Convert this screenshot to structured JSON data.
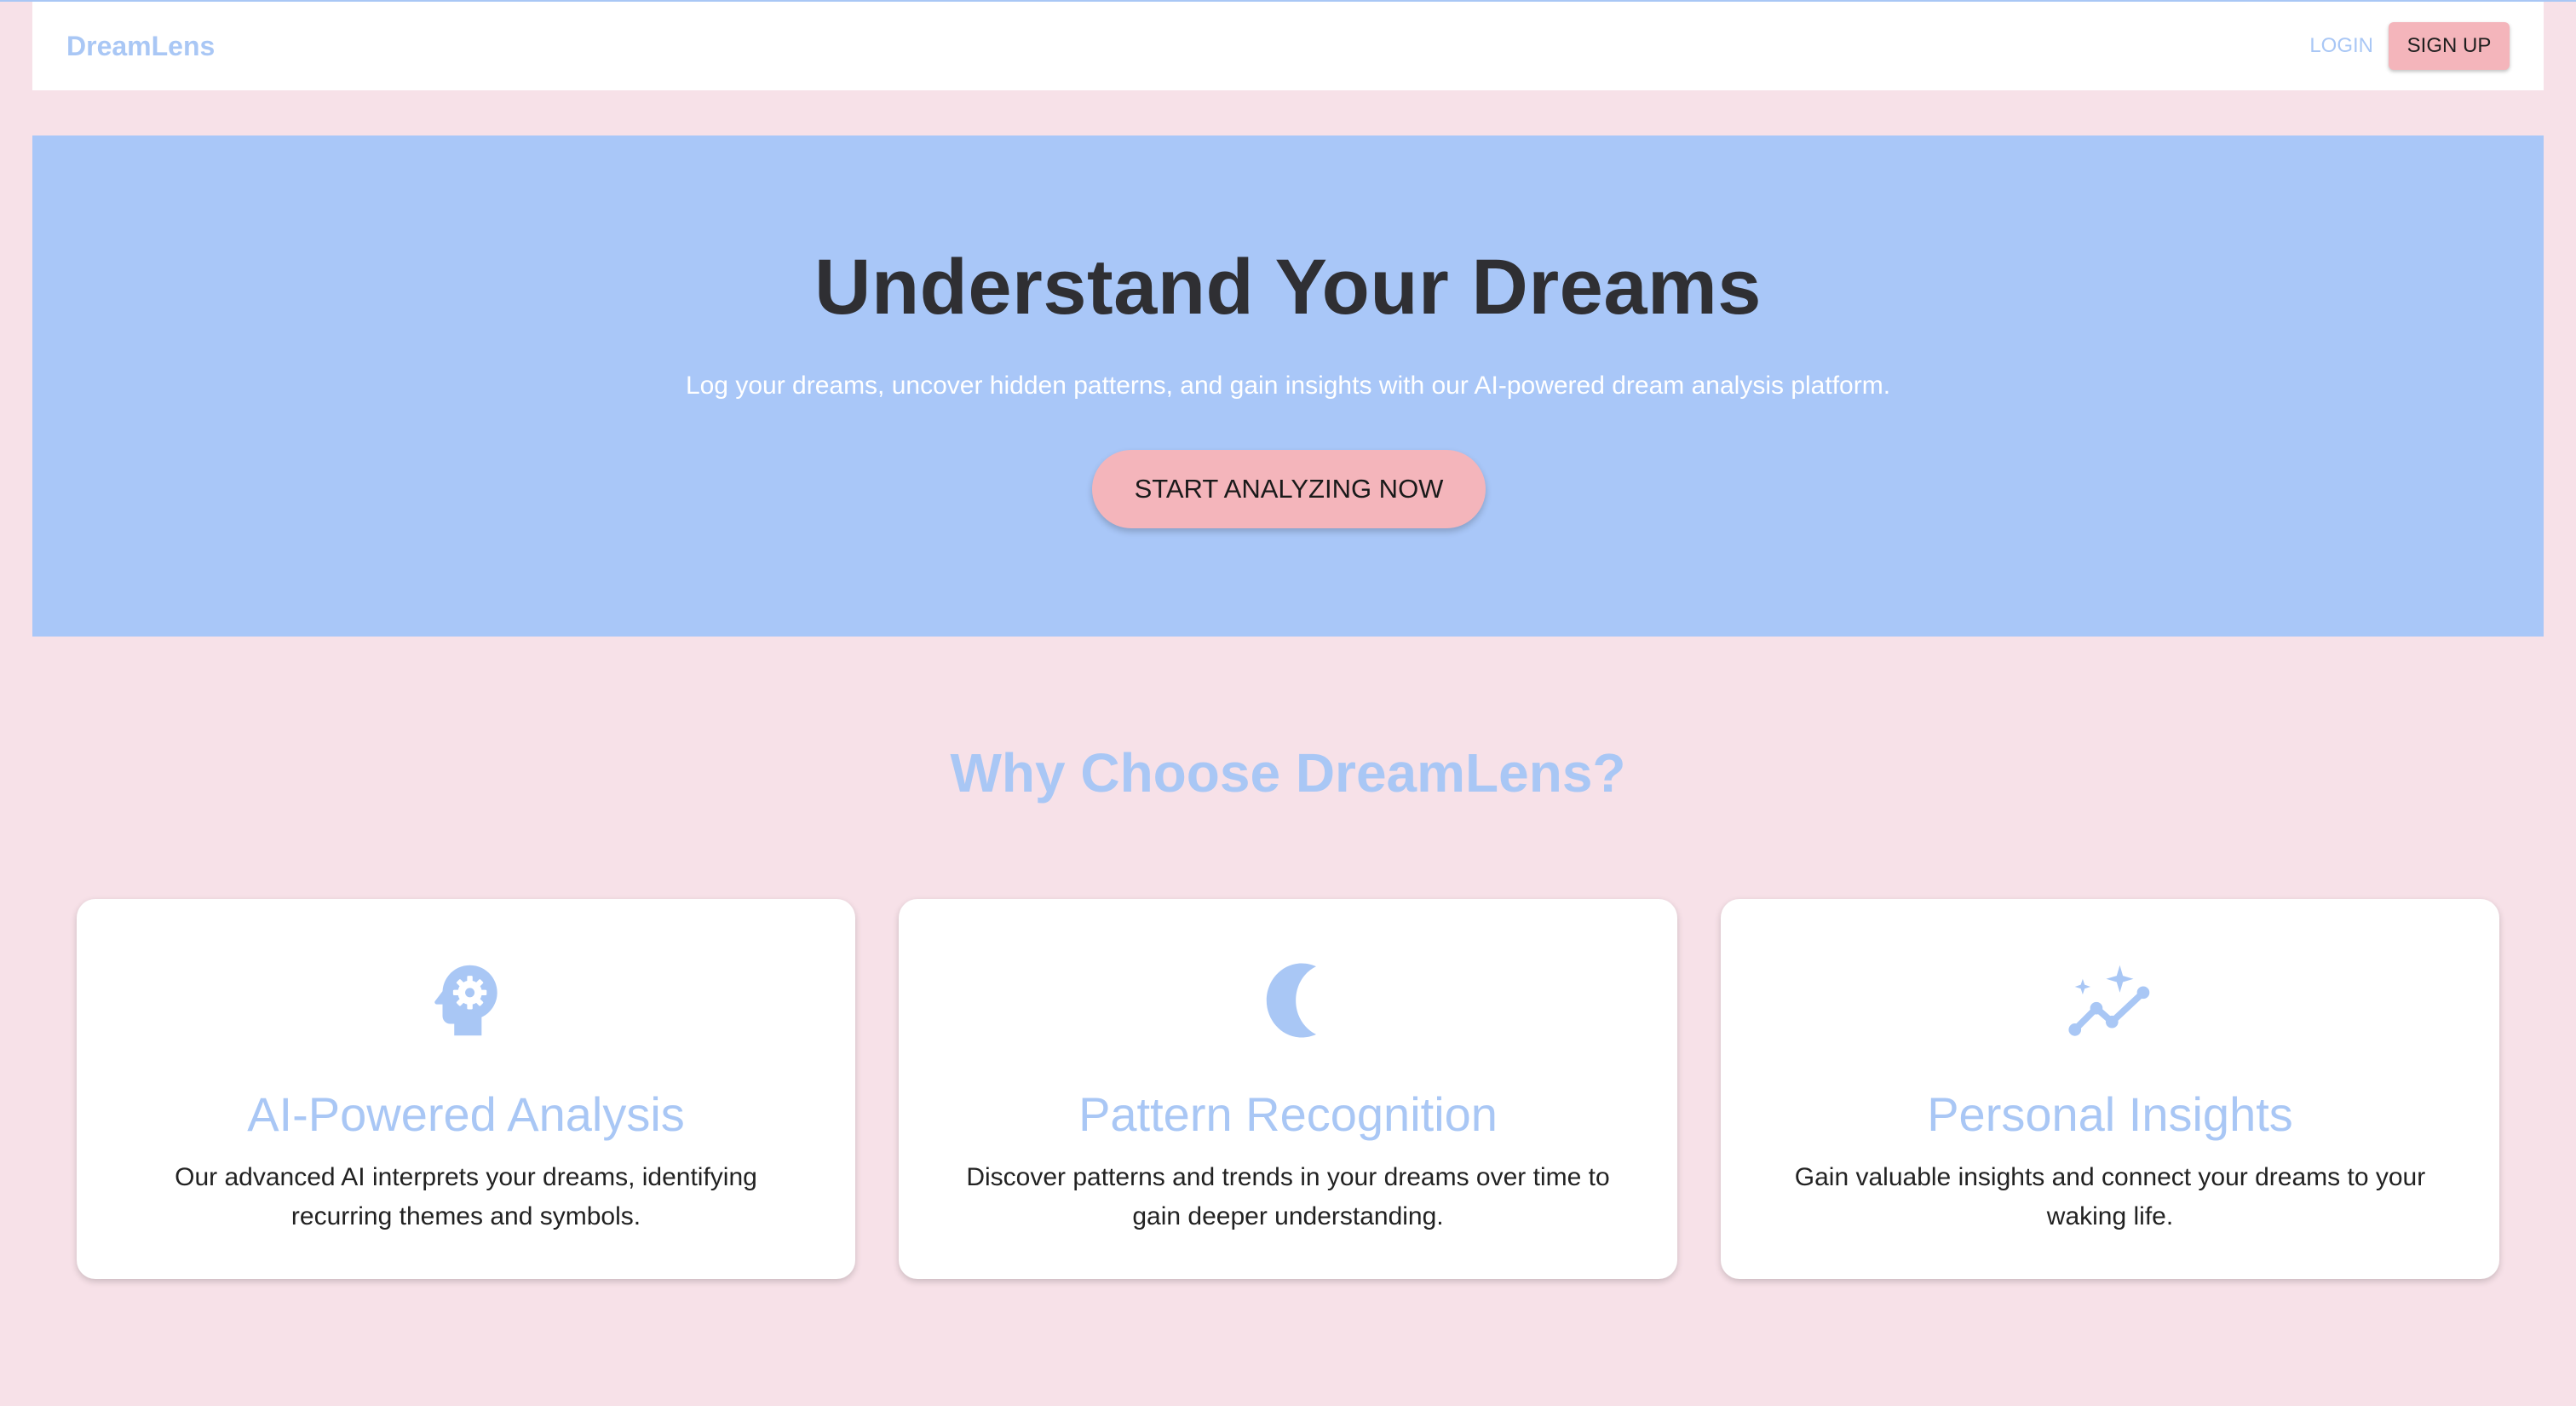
{
  "header": {
    "brand": "DreamLens",
    "login_label": "LOGIN",
    "signup_label": "SIGN UP"
  },
  "hero": {
    "title": "Understand Your Dreams",
    "subtitle": "Log your dreams, uncover hidden patterns, and gain insights with our AI-powered dream analysis platform.",
    "cta_label": "START ANALYZING NOW"
  },
  "features": {
    "title": "Why Choose DreamLens?",
    "cards": [
      {
        "icon": "head-gear-icon",
        "title": "AI-Powered Analysis",
        "description": "Our advanced AI interprets your dreams, identifying recurring themes and symbols."
      },
      {
        "icon": "moon-icon",
        "title": "Pattern Recognition",
        "description": "Discover patterns and trends in your dreams over time to gain deeper understanding."
      },
      {
        "icon": "sparkle-trend-icon",
        "title": "Personal Insights",
        "description": "Gain valuable insights and connect your dreams to your waking life."
      }
    ]
  },
  "colors": {
    "background": "#f7e1e8",
    "accent_blue": "#a9c7f5",
    "accent_pink": "#f4b5bb",
    "text_dark": "#2f2f33"
  }
}
